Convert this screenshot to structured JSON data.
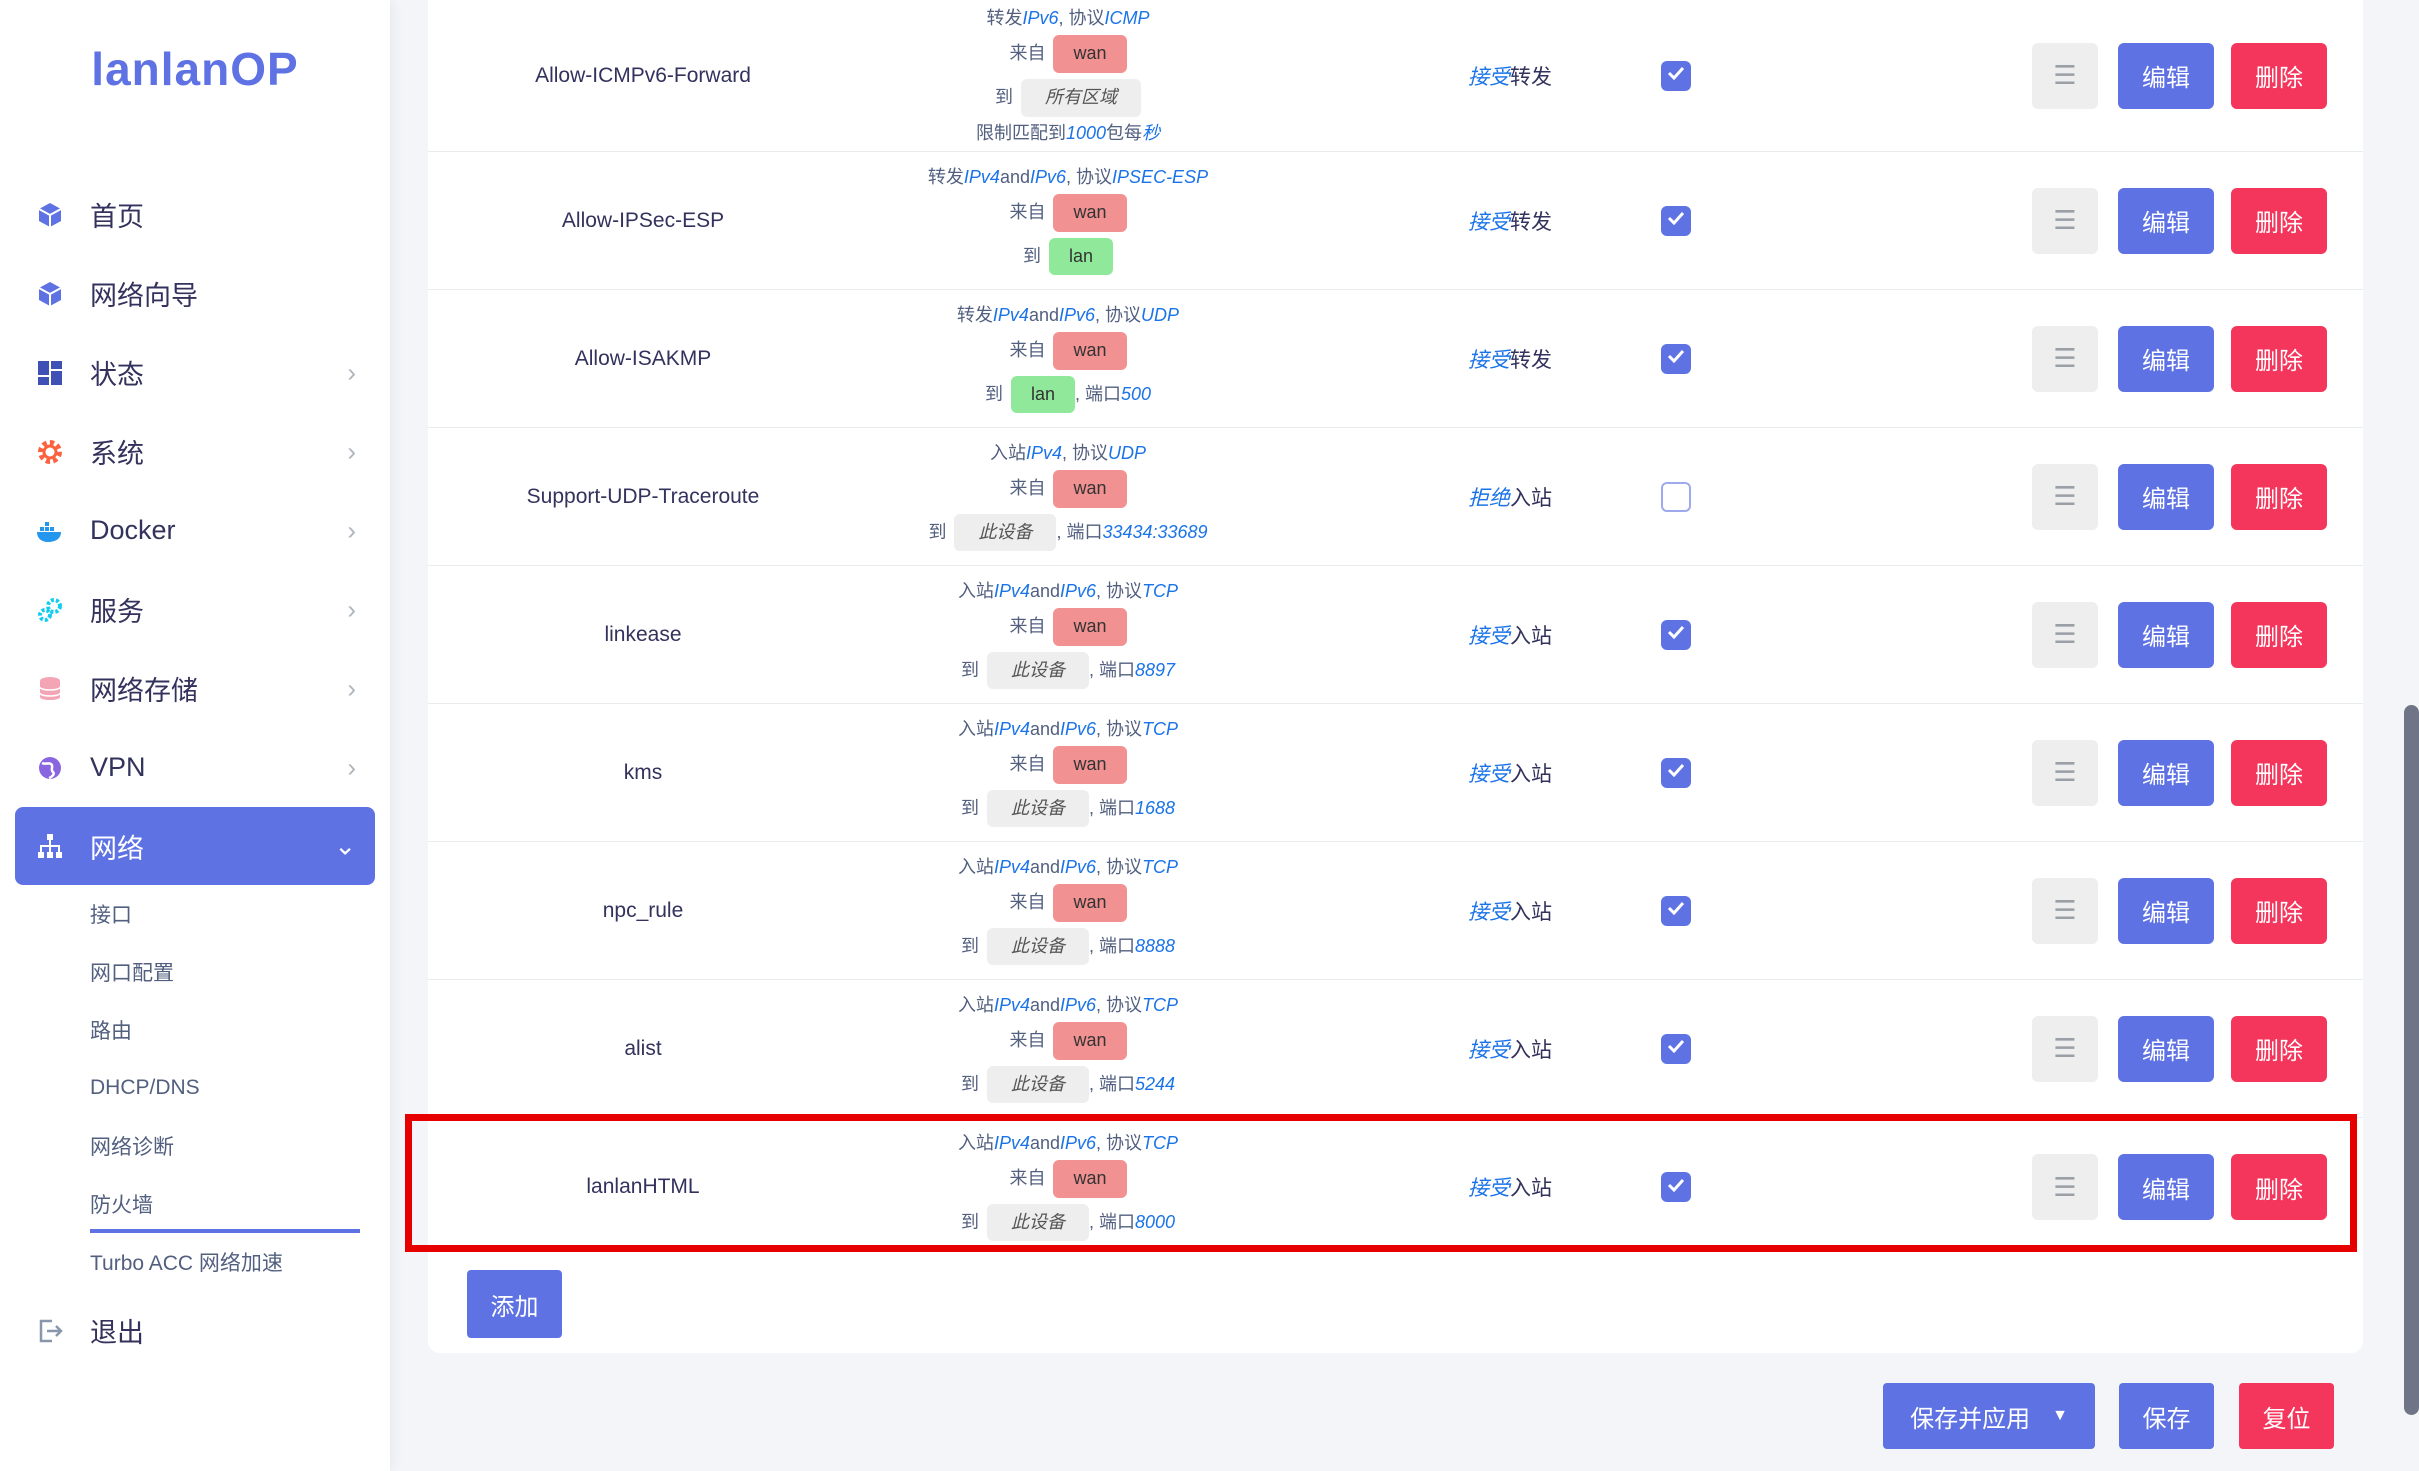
{
  "sidebar": {
    "logo": "lanlanOP",
    "menu": [
      {
        "label": "首页",
        "icon": "cube-icon",
        "chevron": ""
      },
      {
        "label": "网络向导",
        "icon": "cube-icon",
        "chevron": ""
      },
      {
        "label": "状态",
        "icon": "dashboard-icon",
        "chevron": "›"
      },
      {
        "label": "系统",
        "icon": "gear-icon",
        "chevron": "›"
      },
      {
        "label": "Docker",
        "icon": "docker-icon",
        "chevron": "›"
      },
      {
        "label": "服务",
        "icon": "cogs-icon",
        "chevron": "›"
      },
      {
        "label": "网络存储",
        "icon": "database-icon",
        "chevron": "›"
      },
      {
        "label": "VPN",
        "icon": "globe-icon",
        "chevron": "›"
      },
      {
        "label": "网络",
        "icon": "network-icon",
        "chevron": "⌄"
      }
    ],
    "submenu": [
      "接口",
      "网口配置",
      "路由",
      "DHCP/DNS",
      "网络诊断",
      "防火墙",
      "Turbo ACC 网络加速"
    ],
    "logout": "退出"
  },
  "common": {
    "edit": "编辑",
    "delete": "删除",
    "drag": "☰",
    "from": "来自",
    "to": "到"
  },
  "rules": [
    {
      "name": "Allow-ICMPv6-Forward",
      "line1": [
        "转发 ",
        "IPv6",
        ", 协议 ",
        "ICMP"
      ],
      "from": "wan",
      "to": "所有区域",
      "to_type": "zone",
      "port_prefix": "",
      "port": "",
      "limit": [
        "限制匹配到 ",
        "1000",
        "包每 ",
        "秒"
      ],
      "action": "接受",
      "action_suffix": "转发",
      "enabled": true
    },
    {
      "name": "Allow-IPSec-ESP",
      "line1": [
        "转发 ",
        "IPv4",
        " and ",
        "IPv6",
        ", 协议 ",
        "IPSEC-ESP"
      ],
      "from": "wan",
      "to": "lan",
      "to_type": "lan",
      "port_prefix": "",
      "port": "",
      "action": "接受",
      "action_suffix": "转发",
      "enabled": true
    },
    {
      "name": "Allow-ISAKMP",
      "line1": [
        "转发 ",
        "IPv4",
        " and ",
        "IPv6",
        ", 协议 ",
        "UDP"
      ],
      "from": "wan",
      "to": "lan",
      "to_type": "lan",
      "port_prefix": ", 端口 ",
      "port": "500",
      "action": "接受",
      "action_suffix": "转发",
      "enabled": true
    },
    {
      "name": "Support-UDP-Traceroute",
      "line1": [
        "入站 ",
        "IPv4",
        ", 协议 ",
        "UDP"
      ],
      "from": "wan",
      "to": "此设备",
      "to_type": "zone",
      "port_prefix": ", 端口 ",
      "port": "33434:33689",
      "action": "拒绝",
      "action_suffix": "入站",
      "enabled": false
    },
    {
      "name": "linkease",
      "line1": [
        "入站 ",
        "IPv4",
        " and ",
        "IPv6",
        ", 协议 ",
        "TCP"
      ],
      "from": "wan",
      "to": "此设备",
      "to_type": "zone",
      "port_prefix": ", 端口 ",
      "port": "8897",
      "action": "接受",
      "action_suffix": "入站",
      "enabled": true
    },
    {
      "name": "kms",
      "line1": [
        "入站 ",
        "IPv4",
        " and ",
        "IPv6",
        ", 协议 ",
        "TCP"
      ],
      "from": "wan",
      "to": "此设备",
      "to_type": "zone",
      "port_prefix": ", 端口 ",
      "port": "1688",
      "action": "接受",
      "action_suffix": "入站",
      "enabled": true
    },
    {
      "name": "npc_rule",
      "line1": [
        "入站 ",
        "IPv4",
        " and ",
        "IPv6",
        ", 协议 ",
        "TCP"
      ],
      "from": "wan",
      "to": "此设备",
      "to_type": "zone",
      "port_prefix": ", 端口 ",
      "port": "8888",
      "action": "接受",
      "action_suffix": "入站",
      "enabled": true
    },
    {
      "name": "alist",
      "line1": [
        "入站 ",
        "IPv4",
        " and ",
        "IPv6",
        ", 协议 ",
        "TCP"
      ],
      "from": "wan",
      "to": "此设备",
      "to_type": "zone",
      "port_prefix": ", 端口 ",
      "port": "5244",
      "action": "接受",
      "action_suffix": "入站",
      "enabled": true
    },
    {
      "name": "lanlanHTML",
      "line1": [
        "入站 ",
        "IPv4",
        " and ",
        "IPv6",
        ", 协议 ",
        "TCP"
      ],
      "from": "wan",
      "to": "此设备",
      "to_type": "zone",
      "port_prefix": ", 端口 ",
      "port": "8000",
      "action": "接受",
      "action_suffix": "入站",
      "enabled": true
    }
  ],
  "buttons": {
    "add": "添加",
    "save_apply": "保存并应用",
    "save_apply_caret": "▼",
    "save": "保存",
    "reset": "复位"
  },
  "colors": {
    "accent": "#5e72e4",
    "danger": "#f5365c",
    "zone_wan": "#f29191",
    "zone_lan": "#90e89a",
    "highlight": "#e60000"
  }
}
